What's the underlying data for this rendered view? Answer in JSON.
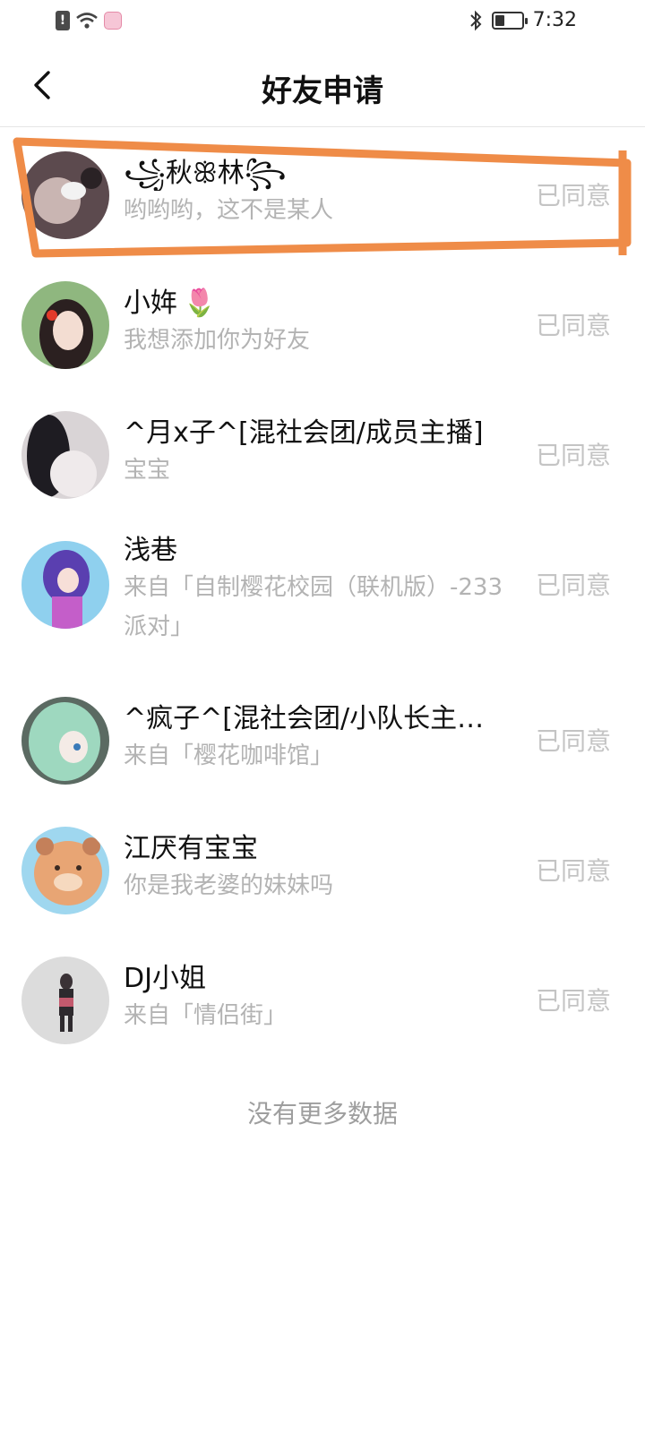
{
  "status_bar": {
    "time": "7:32",
    "icons": [
      "alert-icon",
      "wifi-icon",
      "app-notification-icon",
      "bluetooth-icon",
      "battery-icon"
    ],
    "battery_level": 0.35
  },
  "header": {
    "title": "好友申请",
    "back_icon": "chevron-left-icon"
  },
  "requests": [
    {
      "name": "꧁秋ꕥ林꧂",
      "message": "哟哟哟，这不是某人",
      "status": "已同意",
      "avatar_color": "#6b5a5c",
      "highlighted": true
    },
    {
      "name": "小姩",
      "name_emoji": "🌷",
      "message": "我想添加你为好友",
      "status": "已同意",
      "avatar_color": "#7aa36d"
    },
    {
      "name": "^月x子^[混社会团/成员主播]",
      "message": "宝宝",
      "status": "已同意",
      "avatar_color": "#3b3b40"
    },
    {
      "name": "浅巷",
      "message": "来自「自制樱花校园（联机版）-233派对」",
      "status": "已同意",
      "avatar_color": "#7b62c9"
    },
    {
      "name": "^疯子^[混社会团/小队长主…",
      "message": "来自「樱花咖啡馆」",
      "status": "已同意",
      "avatar_color": "#7fb8a2"
    },
    {
      "name": "江厌有宝宝",
      "message": "你是我老婆的妹妹吗",
      "status": "已同意",
      "avatar_color": "#e7a77a"
    },
    {
      "name": "DJ小姐",
      "message": "来自「情侣街」",
      "status": "已同意",
      "avatar_color": "#d9d9d9"
    }
  ],
  "footer": {
    "no_more_text": "没有更多数据"
  },
  "colors": {
    "highlight": "#ef8c48",
    "status_text": "#c4c4c4",
    "sub_text": "#b3b3b3"
  }
}
